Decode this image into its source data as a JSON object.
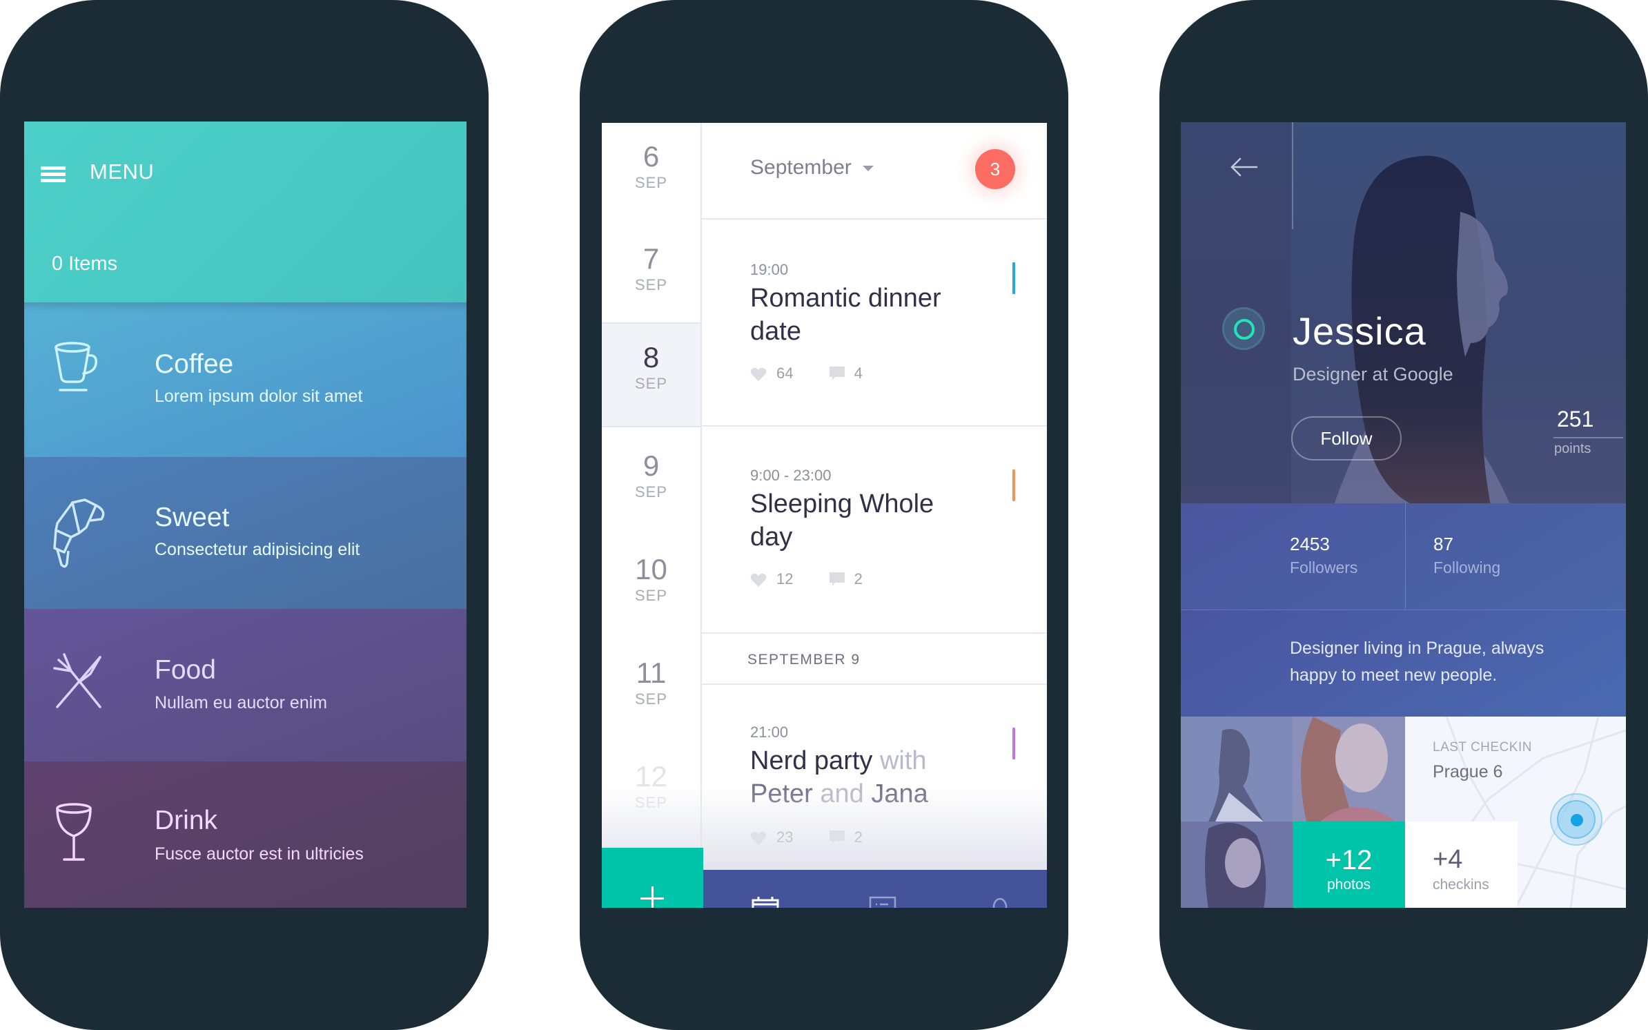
{
  "colors": {
    "device": "#1b2c36",
    "teal": "#00c4aa",
    "badge": "#fb6c63",
    "event_blue": "#22a9e1",
    "event_orange": "#f39356",
    "event_purple": "#c273e6",
    "nav": "#445399",
    "online": "#22e3b7"
  },
  "menu_screen": {
    "header": {
      "icon": "hamburger-icon",
      "title": "MENU",
      "items_count": "0 Items"
    },
    "items": [
      {
        "icon": "coffee-cup-icon",
        "title": "Coffee",
        "subtitle": "Lorem ipsum dolor sit amet"
      },
      {
        "icon": "croissant-icon",
        "title": "Sweet",
        "subtitle": "Consectetur adipisicing elit"
      },
      {
        "icon": "fork-knife-icon",
        "title": "Food",
        "subtitle": "Nullam eu auctor enim"
      },
      {
        "icon": "wine-glass-icon",
        "title": "Drink",
        "subtitle": "Fusce auctor est in ultricies"
      }
    ]
  },
  "calendar_screen": {
    "month": "September",
    "notification_count": "3",
    "dates": [
      {
        "day": "6",
        "month": "SEP",
        "state": "normal"
      },
      {
        "day": "7",
        "month": "SEP",
        "state": "normal"
      },
      {
        "day": "8",
        "month": "SEP",
        "state": "selected"
      },
      {
        "day": "9",
        "month": "SEP",
        "state": "normal"
      },
      {
        "day": "10",
        "month": "SEP",
        "state": "normal"
      },
      {
        "day": "11",
        "month": "SEP",
        "state": "normal"
      },
      {
        "day": "12",
        "month": "SEP",
        "state": "faded"
      }
    ],
    "events": [
      {
        "time": "19:00",
        "title": "Romantic dinner date",
        "likes": "64",
        "comments": "4",
        "color": "#22a9e1"
      },
      {
        "time": "9:00 - 23:00",
        "title": "Sleeping Whole day",
        "likes": "12",
        "comments": "2",
        "color": "#f39356"
      },
      {
        "time": "21:00",
        "title_parts": [
          "Nerd party",
          "with",
          "Peter",
          "and",
          "Jana"
        ],
        "likes": "23",
        "comments": "2",
        "color": "#c273e6"
      }
    ],
    "section_label": "SEPTEMBER 9",
    "add_button": "+",
    "nav": [
      "calendar-icon",
      "list-card-icon",
      "user-icon"
    ]
  },
  "profile_screen": {
    "name": "Jessica",
    "role": "Designer at Google",
    "follow_label": "Follow",
    "points_value": "251",
    "points_label": "points",
    "followers_value": "2453",
    "followers_label": "Followers",
    "following_value": "87",
    "following_label": "Following",
    "bio": "Designer living in Prague, always happy to meet new people.",
    "photos_count": "+12",
    "photos_label": "photos",
    "last_checkin_label": "LAST CHECKIN",
    "last_checkin_place": "Prague 6",
    "checkins_count": "+4",
    "checkins_label": "checkins"
  }
}
